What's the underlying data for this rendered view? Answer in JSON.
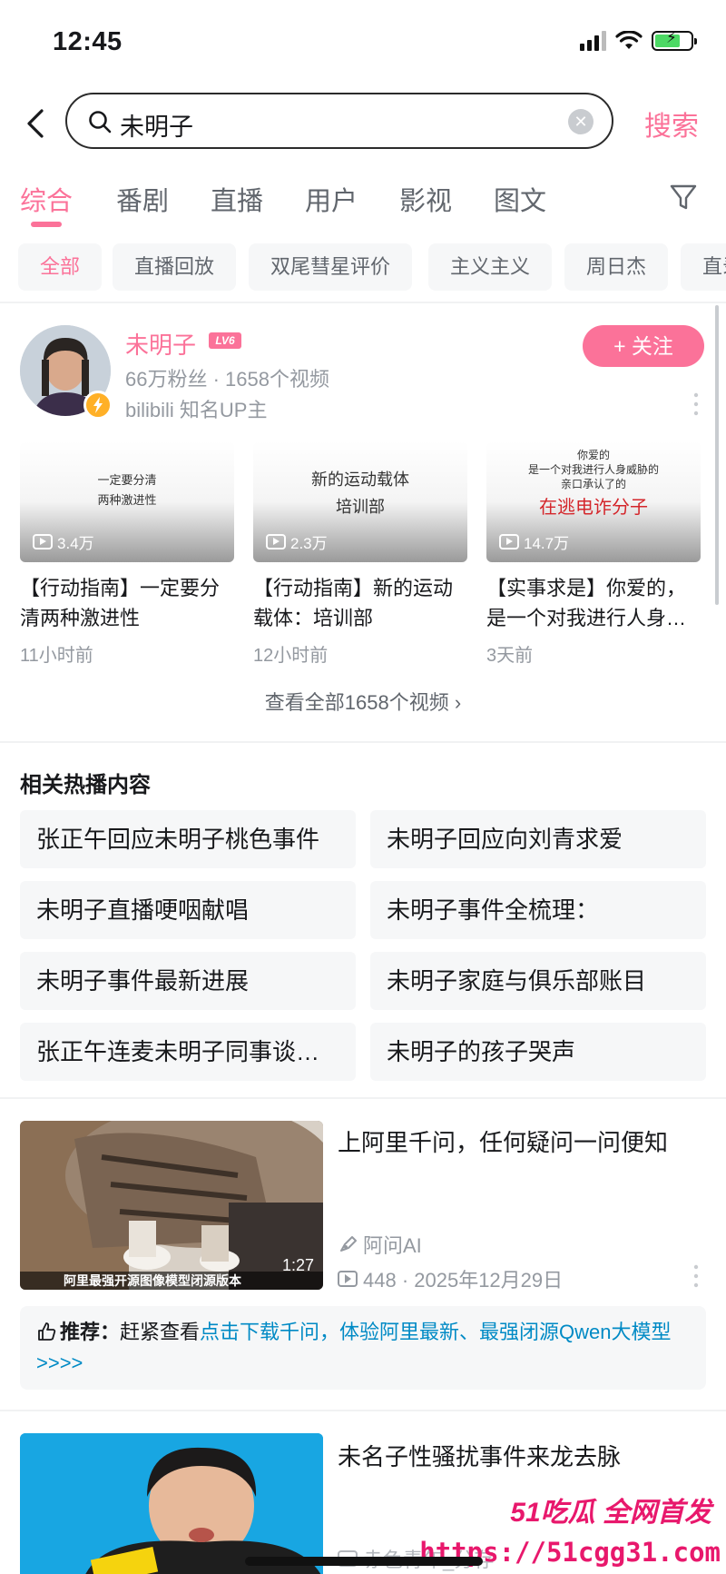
{
  "status": {
    "time": "12:45"
  },
  "search": {
    "query": "未明子",
    "button": "搜索"
  },
  "tabs": [
    "综合",
    "番剧",
    "直播",
    "用户",
    "影视",
    "图文"
  ],
  "chips": [
    "全部",
    "直播回放",
    "双尾彗星评价",
    "主义主义",
    "周日杰",
    "直录"
  ],
  "user": {
    "name": "未明子",
    "level": "LV6",
    "stats": "66万粉丝 · 1658个视频",
    "desc": "bilibili 知名UP主",
    "follow": "+ 关注"
  },
  "videos": [
    {
      "thumb_lines": [
        "一定要分清",
        "两种激进性"
      ],
      "plays": "3.4万",
      "title": "【行动指南】一定要分清两种激进性",
      "time": "11小时前"
    },
    {
      "thumb_lines": [
        "新的运动载体",
        "培训部"
      ],
      "plays": "2.3万",
      "title": "【行动指南】新的运动载体：培训部",
      "time": "12小时前"
    },
    {
      "thumb_lines": [
        "你爱的",
        "是一个对我进行人身威胁的",
        "亲口承认了的"
      ],
      "thumb_red": "在逃电诈分子",
      "plays": "14.7万",
      "title": "【实事求是】你爱的，是一个对我进行人身…",
      "time": "3天前"
    }
  ],
  "view_all": "查看全部1658个视频 ›",
  "hot": {
    "title": "相关热播内容",
    "items": [
      "张正午回应未明子桃色事件",
      "未明子回应向刘青求爱",
      "未明子直播哽咽献唱",
      "未明子事件全梳理：",
      "未明子事件最新进展",
      "未明子家庭与俱乐部账目",
      "张正午连麦未明子同事谈…",
      "未明子的孩子哭声"
    ]
  },
  "ad": {
    "title": "上阿里千问，任何疑问一问便知",
    "author": "阿问AI",
    "meta": "448 · 2025年12月29日",
    "duration": "1:27",
    "caption": "阿里最强开源图像模型闭源版本",
    "recommend_prefix": "推荐：",
    "recommend_text": "赶紧查看",
    "recommend_link": "点击下载千问，体验阿里最新、最强闭源Qwen大模型>>>>"
  },
  "video2": {
    "title": "未名子性骚扰事件来龙去脉",
    "author": "赤色青年_分存"
  },
  "watermark": {
    "brand": "51吃瓜 全网首发",
    "url": "https://51cgg31.com"
  }
}
